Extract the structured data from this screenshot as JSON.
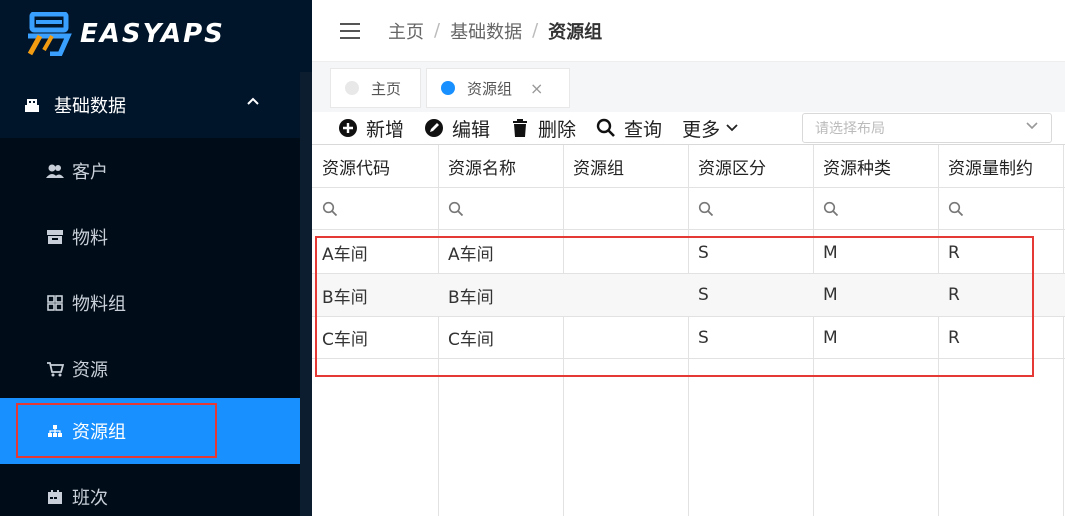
{
  "app": {
    "brand": "EASYAPS"
  },
  "sidebar": {
    "group": {
      "label": "基础数据",
      "icon": "building-icon"
    },
    "items": [
      {
        "label": "客户",
        "icon": "users-icon"
      },
      {
        "label": "物料",
        "icon": "box-icon"
      },
      {
        "label": "物料组",
        "icon": "grid-icon"
      },
      {
        "label": "资源",
        "icon": "cart-icon"
      },
      {
        "label": "资源组",
        "icon": "sitemap-icon",
        "active": true
      },
      {
        "label": "班次",
        "icon": "calendar-icon"
      }
    ]
  },
  "header": {
    "breadcrumb": [
      "主页",
      "基础数据",
      "资源组"
    ]
  },
  "tabs": [
    {
      "label": "主页",
      "active": false
    },
    {
      "label": "资源组",
      "active": true,
      "close": "×"
    }
  ],
  "toolbar": {
    "add": "新增",
    "edit": "编辑",
    "delete": "删除",
    "query": "查询",
    "more": "更多",
    "layout_placeholder": "请选择布局"
  },
  "table": {
    "columns": [
      "资源代码",
      "资源名称",
      "资源组",
      "资源区分",
      "资源种类",
      "资源量制约"
    ],
    "rows": [
      [
        "A车间",
        "A车间",
        "",
        "S",
        "M",
        "R"
      ],
      [
        "B车间",
        "B车间",
        "",
        "S",
        "M",
        "R"
      ],
      [
        "C车间",
        "C车间",
        "",
        "S",
        "M",
        "R"
      ]
    ]
  },
  "colors": {
    "sidebar_bg": "#001529",
    "active": "#1890ff",
    "highlight": "#e53935"
  }
}
